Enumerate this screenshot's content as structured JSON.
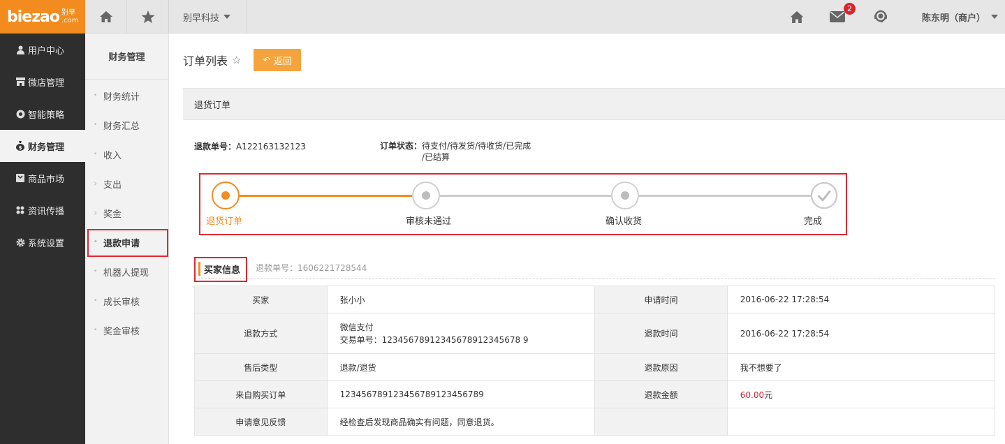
{
  "logo": {
    "main": "biezao",
    "cn": "别早",
    "com": ".com"
  },
  "topbar": {
    "company": "别早科技",
    "mail_badge": "2",
    "user": "陈东明（商户）",
    "icons": [
      "home-icon",
      "star-icon",
      "home-icon",
      "mail-icon",
      "support-icon"
    ]
  },
  "sidebar": {
    "items": [
      {
        "label": "用户中心",
        "icon": "user-icon"
      },
      {
        "label": "微店管理",
        "icon": "shop-icon"
      },
      {
        "label": "智能策略",
        "icon": "strategy-icon"
      },
      {
        "label": "财务管理",
        "icon": "money-bag-icon"
      },
      {
        "label": "商品市场",
        "icon": "market-icon"
      },
      {
        "label": "资讯传播",
        "icon": "share-icon"
      },
      {
        "label": "系统设置",
        "icon": "gear-icon"
      }
    ]
  },
  "subnav": {
    "title": "财务管理",
    "items": [
      {
        "label": "财务统计",
        "marker": "•"
      },
      {
        "label": "财务汇总",
        "marker": "•"
      },
      {
        "label": "收入",
        "marker": "•"
      },
      {
        "label": "支出",
        "marker": "›"
      },
      {
        "label": "奖金",
        "marker": "›"
      },
      {
        "label": "退款申请",
        "marker": "•"
      },
      {
        "label": "机器人提现",
        "marker": "•"
      },
      {
        "label": "成长审核",
        "marker": "•"
      },
      {
        "label": "奖金审核",
        "marker": "•"
      }
    ]
  },
  "page": {
    "title": "订单列表",
    "back_label": "返回"
  },
  "panel": {
    "title": "退货订单",
    "refund_no_label": "退款单号：",
    "refund_no": "A122163132123",
    "status_label": "订单状态：",
    "status_line1": "待支付/待发货/待收货/已完成",
    "status_line2": "/已结算"
  },
  "steps": [
    {
      "label": "退货订单",
      "active": true
    },
    {
      "label": "审核未通过",
      "active": false
    },
    {
      "label": "确认收货",
      "active": false
    },
    {
      "label": "完成",
      "active": false
    }
  ],
  "buyer": {
    "title": "买家信息",
    "sub": "退款单号：1606221728544",
    "rows": [
      {
        "l1": "买家",
        "v1": "张小小",
        "l2": "申请时间",
        "v2": "2016-06-22 17:28:54"
      },
      {
        "l1": "退款方式",
        "v1a": "微信支付",
        "v1b": "交易单号：12345678912345678912345678 9",
        "l2": "退款时间",
        "v2": "2016-06-22 17:28:54"
      },
      {
        "l1": "售后类型",
        "v1": "退款/退货",
        "l2": "退款原因",
        "v2": "我不想要了"
      },
      {
        "l1": "来自购买订单",
        "v1": "123456789123456789123456789",
        "l2": "退款金额",
        "v2_amount": "60.00",
        "v2_unit": "元"
      },
      {
        "l1": "申请意见反馈",
        "v1": "经检查后发现商品确实有问题，同意退货。",
        "l2": "",
        "v2": ""
      }
    ]
  },
  "colors": {
    "brand": "#f28c1e",
    "highlight": "#e0272e",
    "sidebar": "#2e2e2e"
  }
}
